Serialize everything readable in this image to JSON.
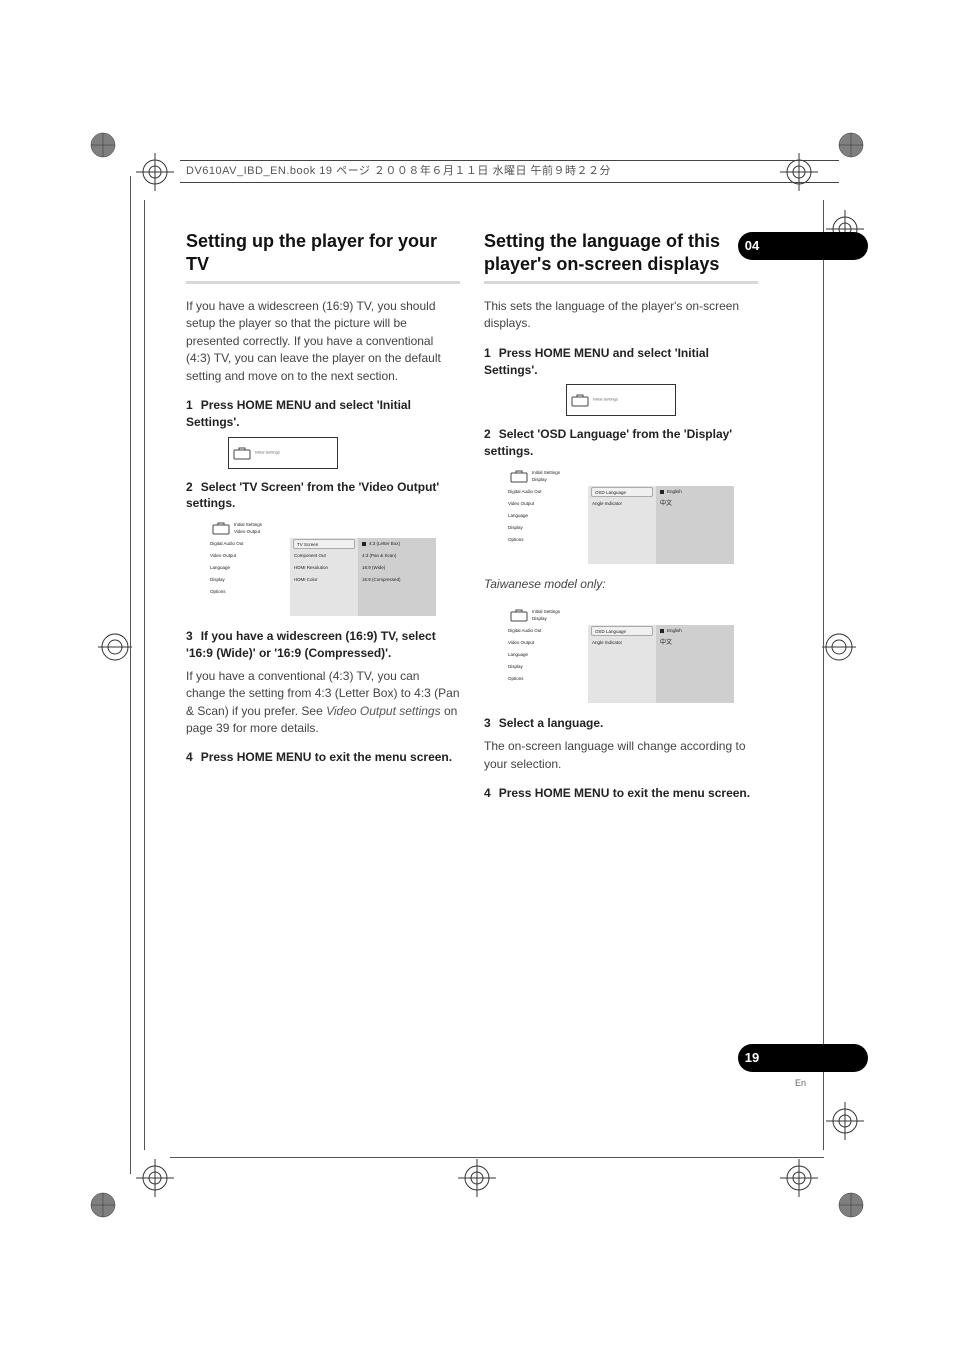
{
  "meta": {
    "header_text": "DV610AV_IBD_EN.book  19 ページ  ２００８年６月１１日  水曜日  午前９時２２分"
  },
  "chapter": {
    "number": "04"
  },
  "page": {
    "number": "19",
    "lang": "En"
  },
  "left": {
    "heading": "Setting up the player for your TV",
    "intro": "If you have a widescreen (16:9) TV, you should setup the player so that the picture will be presented correctly. If you have a conventional (4:3) TV, you can leave the player on the default setting and move on to the next section.",
    "step1_num": "1",
    "step1": "Press HOME MENU and select 'Initial Settings'.",
    "ui_small_label": "Initial Settings",
    "step2_num": "2",
    "step2": "Select 'TV Screen' from the 'Video Output' settings.",
    "ui_large": {
      "top1": "Initial Settings",
      "top2": "Video Output",
      "left_items": [
        "Digital Audio Out",
        "Video Output",
        "Language",
        "Display",
        "Options"
      ],
      "mid_items": [
        "TV Screen",
        "Component Out",
        "HDMI Resolution",
        "HDMI Color"
      ],
      "right_items": [
        "4:3 (Letter Box)",
        "4:3 (Pan & Scan)",
        "16:9 (Wide)",
        "16:9 (Compressed)"
      ]
    },
    "step3_num": "3",
    "step3_lead": "If you have a widescreen (16:9) TV, select '16:9 (Wide)' or '16:9 (Compressed)'.",
    "step3_body_a": "If you have a conventional (4:3) TV, you can change the setting from ",
    "step3_body_b": "4:3 (Letter Box)",
    "step3_body_c": " to ",
    "step3_body_d": "4:3 (Pan & Scan)",
    "step3_body_e": " if you prefer. See ",
    "step3_body_f": "Video Output settings",
    "step3_body_g": " on page 39 for more details.",
    "step4_num": "4",
    "step4": "Press HOME MENU to exit the menu screen."
  },
  "right": {
    "heading": "Setting the language of this player's on-screen displays",
    "intro": "This sets the language of the player's on-screen displays.",
    "step1_num": "1",
    "step1": "Press HOME MENU and select 'Initial Settings'.",
    "ui_small_label": "Initial Settings",
    "step2_num": "2",
    "step2": "Select 'OSD Language' from the 'Display' settings.",
    "ui_large1": {
      "top1": "Initial Settings",
      "top2": "Display",
      "left_items": [
        "Digital Audio Out",
        "Video Output",
        "Language",
        "Display",
        "Options"
      ],
      "mid_items": [
        "OSD Language",
        "Angle Indicator"
      ],
      "right_items": [
        "English",
        "中文"
      ]
    },
    "taiwan_note": "Taiwanese model only:",
    "ui_large2": {
      "top1": "Initial Settings",
      "top2": "Display",
      "left_items": [
        "Digital Audio Out",
        "Video Output",
        "Language",
        "Display",
        "Options"
      ],
      "mid_items": [
        "OSD Language",
        "Angle Indicator"
      ],
      "right_items": [
        "English",
        "中文"
      ]
    },
    "step3_num": "3",
    "step3": "Select a language.",
    "step3_body": "The on-screen language will change according to your selection.",
    "step4_num": "4",
    "step4": "Press HOME MENU to exit the menu screen."
  }
}
